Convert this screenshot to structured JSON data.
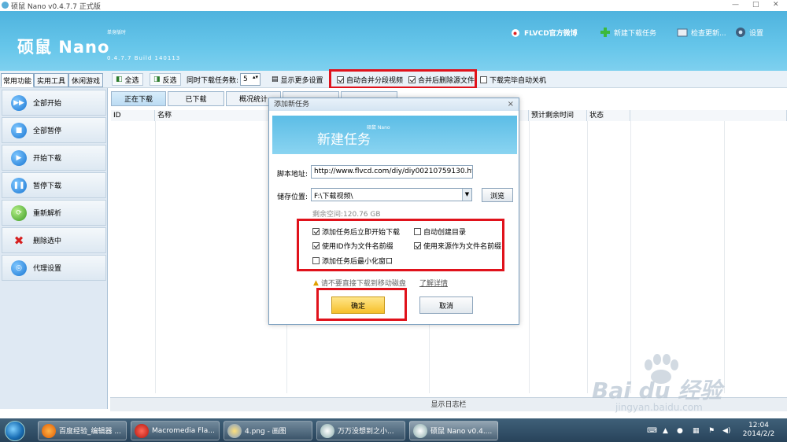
{
  "window": {
    "title": "硕鼠 Nano v0.4.7.7 正式版",
    "minimize": "—",
    "maximize": "□",
    "close": "✕"
  },
  "header": {
    "logo_text": "硕鼠 Nano",
    "logo_sub": "单身版时",
    "version": "0.4.7.7 Build 140113",
    "links": [
      {
        "label": "FLVCD官方微博",
        "icon": "weibo-icon"
      },
      {
        "label": "新建下载任务",
        "icon": "plus-icon"
      },
      {
        "label": "检查更新...",
        "icon": "update-icon"
      },
      {
        "label": "设置",
        "icon": "gear-icon"
      }
    ]
  },
  "main_tabs": [
    "常用功能",
    "实用工具",
    "休闲游戏"
  ],
  "toolbar": {
    "select_all": "全选",
    "invert": "反选",
    "concurrent_label": "同时下载任务数:",
    "concurrent_value": "5",
    "more_settings": "显示更多设置",
    "auto_merge": "自动合并分段视频",
    "delete_source": "合并后删除源文件",
    "auto_shutdown": "下载完毕自动关机"
  },
  "sidebar": {
    "items": [
      {
        "label": "全部开始",
        "icon": "fast-forward-icon"
      },
      {
        "label": "全部暂停",
        "icon": "stop-icon"
      },
      {
        "label": "开始下载",
        "icon": "play-icon"
      },
      {
        "label": "暂停下载",
        "icon": "pause-icon"
      },
      {
        "label": "重新解析",
        "icon": "refresh-icon"
      },
      {
        "label": "删除选中",
        "icon": "delete-icon"
      },
      {
        "label": "代理设置",
        "icon": "globe-icon"
      }
    ]
  },
  "content_tabs": [
    "正在下载",
    "已下载",
    "概况统计",
    "",
    ""
  ],
  "columns": [
    "ID",
    "名称",
    "预计剩余时间",
    "状态"
  ],
  "log_bar": "显示日志栏",
  "dialog": {
    "title": "添加新任务",
    "close": "×",
    "banner_title": "新建任务",
    "banner_sub": "硕鼠 Nano",
    "script_label": "脚本地址:",
    "script_value": "http://www.flvcd.com/diy/diy00210759130.htm",
    "storage_label": "储存位置:",
    "storage_value": "F:\\下载视频\\",
    "browse": "浏览",
    "free_space": "剩余空间:120.76 GB",
    "options": [
      {
        "label": "添加任务后立即开始下载",
        "checked": true
      },
      {
        "label": "自动创建目录",
        "checked": false
      },
      {
        "label": "使用ID作为文件名前缀",
        "checked": true
      },
      {
        "label": "使用来源作为文件名前缀",
        "checked": true
      },
      {
        "label": "添加任务后最小化窗口",
        "checked": false
      }
    ],
    "warning": "请不要直接下载到移动磁盘",
    "learn_more": "了解详情",
    "ok": "确定",
    "cancel": "取消"
  },
  "taskbar": {
    "tasks": [
      "百度经验_编辑器 ...",
      "Macromedia Fla...",
      "4.png - 画图",
      "万万没想到之小...",
      "硕鼠 Nano v0.4...."
    ],
    "clock_time": "12:04",
    "clock_date": "2014/2/2"
  },
  "watermark": {
    "brand": "Bai du 经验",
    "url": "jingyan.baidu.com"
  }
}
